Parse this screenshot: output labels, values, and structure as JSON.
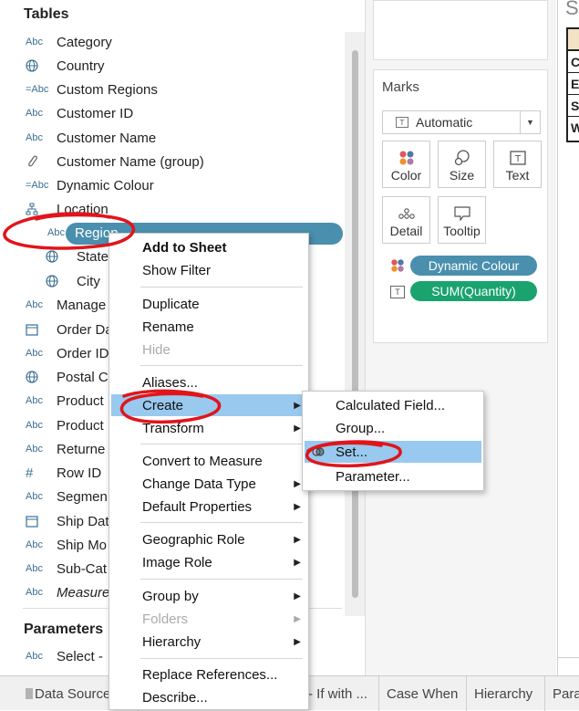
{
  "left_pane": {
    "tables_heading": "Tables",
    "fields": [
      {
        "icon": "Abc",
        "icon_name": "string-type-icon",
        "label": "Category"
      },
      {
        "icon": "globe",
        "icon_name": "globe-icon",
        "label": "Country"
      },
      {
        "icon": "=Abc",
        "icon_name": "calculated-string-icon",
        "label": "Custom Regions"
      },
      {
        "icon": "Abc",
        "icon_name": "string-type-icon",
        "label": "Customer ID"
      },
      {
        "icon": "Abc",
        "icon_name": "string-type-icon",
        "label": "Customer Name"
      },
      {
        "icon": "clip",
        "icon_name": "paperclip-group-icon",
        "label": "Customer Name (group)"
      },
      {
        "icon": "=Abc",
        "icon_name": "calculated-string-icon",
        "label": "Dynamic Colour"
      },
      {
        "icon": "hier",
        "icon_name": "hierarchy-icon",
        "label": "Location"
      },
      {
        "icon": "Abc",
        "icon_name": "string-type-icon",
        "label": "Region"
      },
      {
        "icon": "globe",
        "icon_name": "globe-icon",
        "label": "State"
      },
      {
        "icon": "globe",
        "icon_name": "globe-icon",
        "label": "City"
      },
      {
        "icon": "Abc",
        "icon_name": "string-type-icon",
        "label": "Manage"
      },
      {
        "icon": "cal",
        "icon_name": "calendar-icon",
        "label": "Order Da"
      },
      {
        "icon": "Abc",
        "icon_name": "string-type-icon",
        "label": "Order ID"
      },
      {
        "icon": "globe",
        "icon_name": "globe-icon",
        "label": "Postal C"
      },
      {
        "icon": "Abc",
        "icon_name": "string-type-icon",
        "label": "Product"
      },
      {
        "icon": "Abc",
        "icon_name": "string-type-icon",
        "label": "Product"
      },
      {
        "icon": "Abc",
        "icon_name": "string-type-icon",
        "label": "Returne"
      },
      {
        "icon": "#",
        "icon_name": "number-type-icon",
        "label": "Row ID"
      },
      {
        "icon": "Abc",
        "icon_name": "string-type-icon",
        "label": "Segmen"
      },
      {
        "icon": "cal",
        "icon_name": "calendar-icon",
        "label": "Ship Dat"
      },
      {
        "icon": "Abc",
        "icon_name": "string-type-icon",
        "label": "Ship Mo"
      },
      {
        "icon": "Abc",
        "icon_name": "string-type-icon",
        "label": "Sub-Cat"
      },
      {
        "icon": "Abc",
        "icon_name": "string-type-icon",
        "label": "Measure"
      }
    ],
    "parameters_heading": "Parameters",
    "parameters": [
      {
        "icon": "Abc",
        "label": "Select -"
      }
    ]
  },
  "marks": {
    "heading": "Marks",
    "mark_type": "Automatic",
    "buttons": [
      "Color",
      "Size",
      "Text",
      "Detail",
      "Tooltip"
    ],
    "pills": [
      {
        "label": "Dynamic Colour",
        "color": "#4a8fae"
      },
      {
        "label": "SUM(Quantity)",
        "color": "#1aa36e"
      }
    ]
  },
  "sheet": {
    "title_letter": "S",
    "row_letters": [
      "C",
      "E",
      "S",
      "W"
    ]
  },
  "context_menu": {
    "items": [
      "Add to Sheet",
      "Show Filter",
      "Duplicate",
      "Rename",
      "Hide",
      "Aliases...",
      "Create",
      "Transform",
      "Convert to Measure",
      "Change Data Type",
      "Default Properties",
      "Geographic Role",
      "Image Role",
      "Group by",
      "Folders",
      "Hierarchy",
      "Replace References...",
      "Describe..."
    ]
  },
  "create_submenu": {
    "items": [
      "Calculated Field...",
      "Group...",
      "Set...",
      "Parameter..."
    ]
  },
  "tabs": [
    "Data Source",
    "- If with ...",
    "Case When",
    "Hierarchy",
    "Para"
  ],
  "colors": {
    "highlight": "#99c9ef",
    "selected_field": "#4a8fae",
    "annotation": "#e0151b"
  }
}
